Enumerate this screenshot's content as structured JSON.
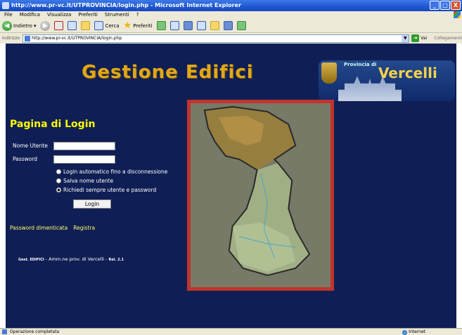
{
  "window": {
    "title": "http://www.pr-vc.it/UTPROVINCIA/login.php - Microsoft Internet Explorer",
    "controls": {
      "minimize": "_",
      "maximize": "□",
      "close": "X"
    }
  },
  "menu": [
    "File",
    "Modifica",
    "Visualizza",
    "Preferiti",
    "Strumenti",
    "?"
  ],
  "toolbar": {
    "back_label": "Indietro",
    "search_label": "Cerca",
    "favorites_label": "Preferiti"
  },
  "address": {
    "label": "Indirizzo",
    "url": "http://www.pr-vc.it/UTPROVINCIA/login.php",
    "go_label": "Vai",
    "links_label": "Collegamenti"
  },
  "header": {
    "title": "Gestione Edifici",
    "banner_small": "Provincia di",
    "banner_big": "Vercelli"
  },
  "login": {
    "title": "Pagina di Login",
    "username_label": "Nome Utente",
    "password_label": "Password",
    "username_value": "",
    "password_value": "",
    "options": [
      {
        "label": "Login automatico fino a disconnessione",
        "checked": false
      },
      {
        "label": "Salva nome utente",
        "checked": false
      },
      {
        "label": "Richiedi sempre utente e password",
        "checked": true
      }
    ],
    "submit_label": "Login"
  },
  "links": {
    "forgot_password": "Password dimenticata",
    "register": "Registra"
  },
  "footer": {
    "app": "Gest. EDIFICI",
    "owner": " - Amm.ne prov. di Vercelli - ",
    "release": "Rel. 2.1"
  },
  "status": {
    "text": "Operazione completata",
    "zone": "Internet"
  }
}
